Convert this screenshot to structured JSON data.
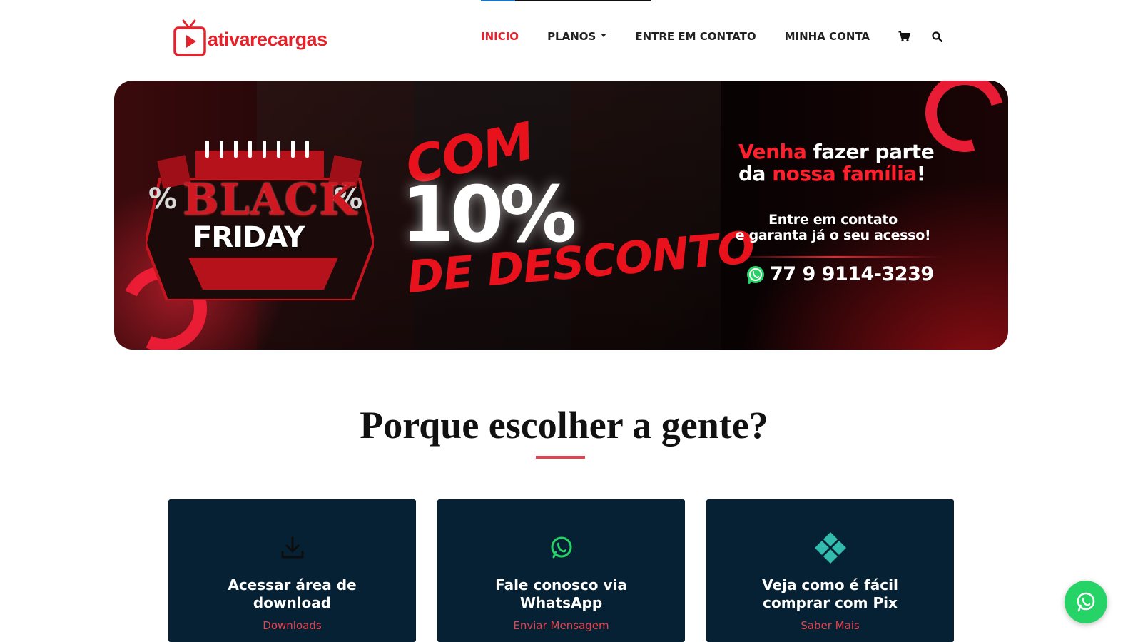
{
  "brand": {
    "logo_text": "ativarecargas",
    "accent_color": "#e4222b",
    "logo_icon": "tv-play-icon"
  },
  "progress": {
    "value_percent": 20
  },
  "nav": {
    "items": [
      {
        "label": "INICIO",
        "active": true
      },
      {
        "label": "PLANOS",
        "has_dropdown": true
      },
      {
        "label": "ENTRE EM CONTATO"
      },
      {
        "label": "MINHA CONTA"
      }
    ],
    "cart_icon": "cart-icon",
    "search_icon": "search-icon"
  },
  "banner": {
    "black": "BLACK",
    "friday": "FRIDAY",
    "pct_symbol": "%",
    "com": "COM",
    "discount": "10%",
    "desconto": "DE DESCONTO",
    "venha_1_red": "Venha",
    "venha_1_rest": " fazer parte",
    "venha_2_start": "da ",
    "venha_2_red": "nossa família",
    "venha_2_end": "!",
    "contact_line_1": "Entre em contato",
    "contact_line_2": "e garanta já o seu acesso!",
    "phone": "77 9 9114-3239",
    "phone_icon": "whatsapp-icon"
  },
  "section": {
    "title": "Porque escolher a gente?",
    "underline_color": "#e7424f"
  },
  "cards": [
    {
      "icon": "download-icon",
      "title_1": "Acessar área de",
      "title_2": "download",
      "link": "Downloads"
    },
    {
      "icon": "whatsapp-icon",
      "title_1": "Fale conosco via",
      "title_2": "WhatsApp",
      "link": "Enviar Mensagem"
    },
    {
      "icon": "pix-icon",
      "title_1": "Veja como é fácil",
      "title_2": "comprar com Pix",
      "link": "Saber Mais"
    }
  ],
  "floating": {
    "icon": "whatsapp-icon",
    "color": "#25d366"
  }
}
